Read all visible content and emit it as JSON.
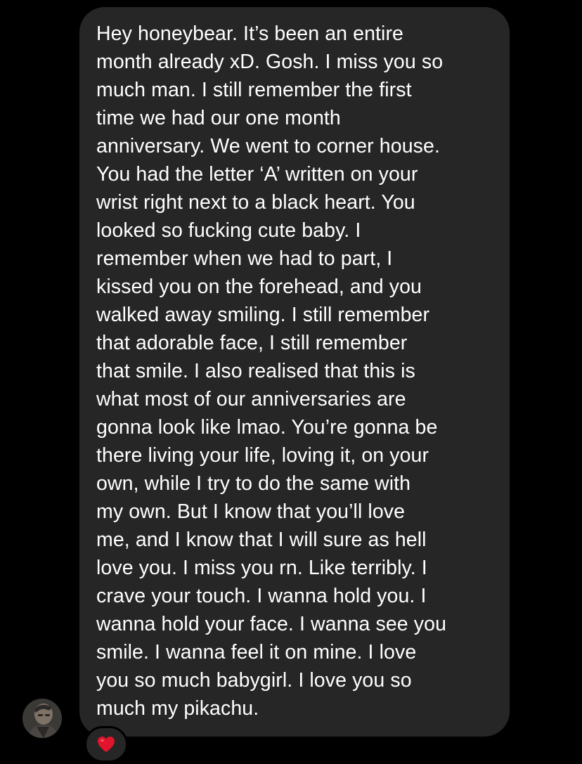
{
  "message": {
    "lines": [
      "Hey honeybear. It’s been an entire",
      "month already xD. Gosh. I miss you so",
      "much man.  I still remember the first",
      "time we had our one month",
      "anniversary. We went to corner house.",
      "You had the letter ‘A’ written on your",
      "wrist right next to a black heart. You",
      "looked so fucking cute baby. I",
      "remember when we had to part, I",
      "kissed you on the forehead, and you",
      "walked away smiling. I still remember",
      "that adorable face, I still remember",
      "that smile. I also realised that this is",
      "what most of our anniversaries are",
      "gonna look like lmao. You’re gonna be",
      "there living your life, loving it, on your",
      "own, while I try to do the same with",
      "my own. But I know that you’ll love",
      "me, and I know that I will sure as hell",
      "love you. I miss you rn. Like terribly. I",
      "crave your touch. I wanna hold you. I",
      "wanna hold your face. I wanna see you",
      "smile. I wanna feel it on mine. I love",
      "you so much babygirl. I love you so",
      "much my pikachu."
    ]
  },
  "reaction": {
    "icon": "red-heart-icon",
    "color": "#e0152d"
  },
  "avatar": {
    "icon": "profile-photo"
  },
  "colors": {
    "background": "#000000",
    "bubble": "#262626",
    "text": "#ffffff"
  }
}
